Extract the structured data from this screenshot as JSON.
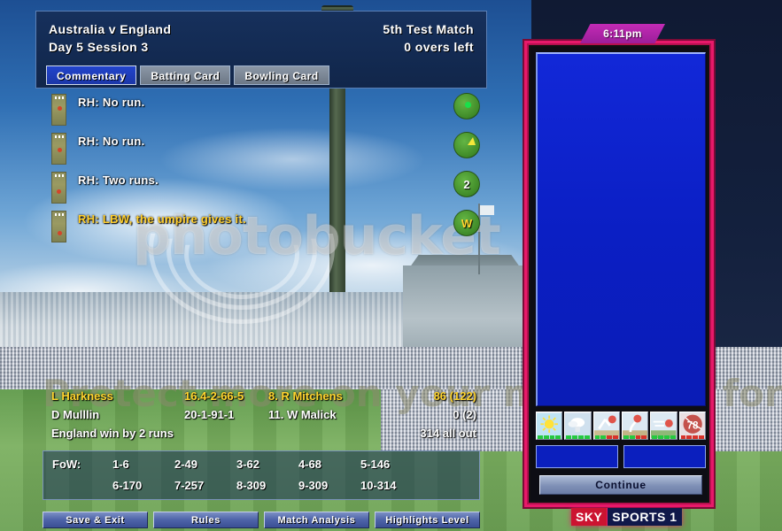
{
  "header": {
    "match_title": "Australia v England",
    "day_session": "Day 5 Session 3",
    "match_type": "5th Test Match",
    "overs_left": "0 overs left"
  },
  "tabs": [
    {
      "label": "Commentary",
      "active": true
    },
    {
      "label": "Batting Card",
      "active": false
    },
    {
      "label": "Bowling Card",
      "active": false
    }
  ],
  "commentary": [
    {
      "text": "RH:  No run.",
      "outcome": "0",
      "wicket": false
    },
    {
      "text": "RH:  No run.",
      "outcome": "0",
      "wicket": false
    },
    {
      "text": "RH:  Two runs.",
      "outcome": "2",
      "wicket": false
    },
    {
      "text": "RH:  LBW, the umpire gives it.",
      "outcome": "W",
      "wicket": true
    }
  ],
  "scorestrip": {
    "bowler_current": {
      "name": "L Harkness",
      "figures": "16.4-2-66-5"
    },
    "bowler_other": {
      "name": "D Mulllin",
      "figures": "20-1-91-1"
    },
    "batsman_current": {
      "name": "8. R Mitchens",
      "score": "86 (122)"
    },
    "batsman_other": {
      "name": "11. W Malick",
      "score": "0 (2)"
    },
    "result": "England win by 2 runs",
    "total": "314 all out"
  },
  "fow": {
    "label": "FoW:",
    "row1": [
      "1-6",
      "2-49",
      "3-62",
      "4-68",
      "5-146"
    ],
    "row2": [
      "6-170",
      "7-257",
      "8-309",
      "9-309",
      "10-314"
    ]
  },
  "buttons": [
    {
      "label": "Save & Exit"
    },
    {
      "label": "Rules"
    },
    {
      "label": "Match Analysis"
    },
    {
      "label": "Highlights Level"
    }
  ],
  "right_panel": {
    "time": "6:11pm",
    "continue_label": "Continue",
    "icons": [
      {
        "name": "weather-sunny-icon",
        "bar": "green"
      },
      {
        "name": "weather-overcast-icon",
        "bar": "green"
      },
      {
        "name": "pitch-bounce-icon",
        "bar": "mixed"
      },
      {
        "name": "pitch-seam-icon",
        "bar": "mixed"
      },
      {
        "name": "pitch-swing-icon",
        "bar": "green"
      },
      {
        "name": "ball-condition-icon",
        "bar": "red",
        "value": "78"
      }
    ]
  },
  "branding": {
    "sky": "SKY",
    "sports": "SPORTS 1"
  },
  "watermark": {
    "top": "photobucket",
    "bottom": "Protect more on your memories for les"
  },
  "colors": {
    "accent_pink": "#e8196a",
    "tab_active": "#2244cc",
    "wicket_gold": "#ffcf2e",
    "header_navy": "#16305c"
  }
}
